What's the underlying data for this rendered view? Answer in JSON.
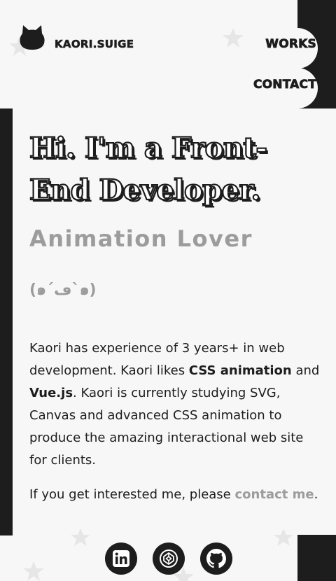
{
  "brand": {
    "name": "KAORI.SUIGE",
    "logo_icon": "cat-head-icon"
  },
  "nav": {
    "works": "WORKS",
    "contact": "CONTACT"
  },
  "hero": {
    "headline_line1": "Hi. I'm a Front-",
    "headline_line2": "End Developer.",
    "subheadline": "Animation Lover",
    "emoticon": "(๑´ڡ`๑)"
  },
  "intro": {
    "part1": "Kaori has experience of 3 years+ in web development. Kaori likes ",
    "highlight1": "CSS animation",
    "part2": " and ",
    "highlight2": "Vue.js",
    "part3": ". Kaori is currently studying SVG, Canvas and advanced CSS animation to produce the amazing interactional web site for clients."
  },
  "cta": {
    "prefix": "If you get interested me, please ",
    "link": "contact me",
    "suffix": "."
  },
  "social": {
    "linkedin": "linkedin-icon",
    "codepen": "codepen-icon",
    "github": "github-icon"
  },
  "colors": {
    "ink": "#1d1d1d",
    "muted": "#9c9c9c",
    "background": "#f7f7f7"
  }
}
